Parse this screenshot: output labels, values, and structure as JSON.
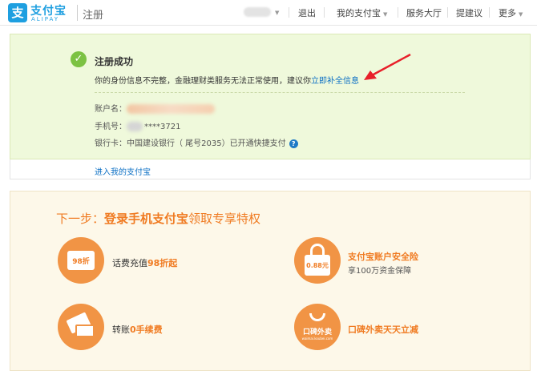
{
  "header": {
    "brand": "支付宝",
    "brand_en": "ALIPAY",
    "page_title": "注册",
    "nav": {
      "logout": "退出",
      "my_alipay": "我的支付宝",
      "service_hall": "服务大厅",
      "feedback": "提建议",
      "more": "更多"
    }
  },
  "success": {
    "title": "注册成功",
    "message": "你的身份信息不完整，金融理财类服务无法正常使用，建议你",
    "link": "立即补全信息",
    "account_label": "账户名：",
    "phone_label": "手机号：",
    "phone_value": "****3721",
    "bank_label": "银行卡：",
    "bank_value": "中国建设银行（ 尾号2035）已开通快捷支付",
    "enter_link": "进入我的支付宝"
  },
  "next_step": {
    "title_prefix": "下一步：",
    "title_bold": "登录手机支付宝",
    "title_suffix": "领取专享特权",
    "perks": [
      {
        "icon": "coupon-98-icon",
        "icon_text": "98折",
        "text": "话费充值",
        "highlight": "98折起"
      },
      {
        "icon": "lock-icon",
        "icon_text": "0.88元",
        "title": "支付宝账户安全险",
        "subtitle": "享100万资金保障"
      },
      {
        "icon": "card-transfer-icon",
        "text": "转账",
        "highlight": "0手续费"
      },
      {
        "icon": "koubei-icon",
        "icon_text": "口碑外卖",
        "icon_sub": "waimai.koubei.com",
        "title": "口碑外卖天天立减"
      }
    ]
  },
  "colors": {
    "brand_blue": "#1e9fe0",
    "success_green": "#7cc243",
    "orange": "#f07b22",
    "arrow_red": "#e8202a"
  }
}
